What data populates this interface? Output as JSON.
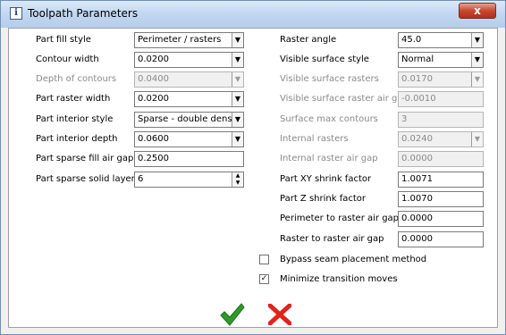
{
  "window": {
    "title": "Toolpath Parameters",
    "close_glyph": "x"
  },
  "left": {
    "part_fill_style": {
      "label": "Part fill style",
      "value": "Perimeter  /  rasters"
    },
    "contour_width": {
      "label": "Contour width",
      "value": "0.0200"
    },
    "depth_of_contours": {
      "label": "Depth of contours",
      "value": "0.0400"
    },
    "part_raster_width": {
      "label": "Part raster width",
      "value": "0.0200"
    },
    "part_interior_style": {
      "label": "Part interior style",
      "value": "Sparse - double dense"
    },
    "part_interior_depth": {
      "label": "Part interior depth",
      "value": "0.0600"
    },
    "part_sparse_fill_air_gap": {
      "label": "Part sparse fill air gap",
      "value": "0.2500"
    },
    "part_sparse_solid_layers": {
      "label": "Part sparse solid layers",
      "value": "6"
    }
  },
  "right": {
    "raster_angle": {
      "label": "Raster angle",
      "value": "45.0"
    },
    "visible_surface_style": {
      "label": "Visible surface style",
      "value": "Normal"
    },
    "visible_surface_rasters": {
      "label": "Visible surface rasters",
      "value": "0.0170"
    },
    "visible_surface_raster_air_gap": {
      "label": "Visible surface raster air gap",
      "value": "-0.0010"
    },
    "surface_max_contours": {
      "label": "Surface max contours",
      "value": "3"
    },
    "internal_rasters": {
      "label": "Internal rasters",
      "value": "0.0240"
    },
    "internal_raster_air_gap": {
      "label": "Internal raster air gap",
      "value": "0.0000"
    },
    "part_xy_shrink_factor": {
      "label": "Part XY shrink factor",
      "value": "1.0071"
    },
    "part_z_shrink_factor": {
      "label": "Part Z shrink factor",
      "value": "1.0070"
    },
    "perimeter_to_raster_air_gap": {
      "label": "Perimeter to raster air gap",
      "value": "0.0000"
    },
    "raster_to_raster_air_gap": {
      "label": "Raster to raster air gap",
      "value": "0.0000"
    }
  },
  "options": {
    "bypass_seam": {
      "label": "Bypass seam placement method",
      "checked": false,
      "mark": ""
    },
    "minimize_transition": {
      "label": "Minimize transition moves",
      "checked": true,
      "mark": "✓"
    }
  },
  "icons": {
    "ok": "green-check-icon",
    "cancel": "red-x-icon"
  },
  "colors": {
    "ok_green": "#2e9a2a",
    "cancel_red": "#e2231a",
    "disabled_text": "#8a8a8a"
  }
}
